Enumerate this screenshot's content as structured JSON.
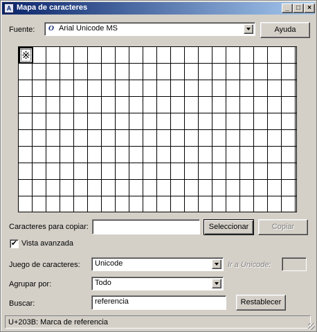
{
  "window": {
    "title": "Mapa de caracteres",
    "minimize": "_",
    "maximize": "□",
    "close": "×"
  },
  "font": {
    "label": "Fuente:",
    "value": "Arial Unicode MS",
    "icon_glyph": "O"
  },
  "help_button": "Ayuda",
  "grid": {
    "selected_char": "※",
    "rows": 10,
    "cols": 20
  },
  "copy": {
    "label": "Caracteres para copiar:",
    "value": "",
    "select_button": "Seleccionar",
    "copy_button": "Copiar"
  },
  "advanced": {
    "label": "Vista avanzada",
    "checked": true,
    "check_glyph": "✔"
  },
  "charset": {
    "label": "Juego de caracteres:",
    "value": "Unicode"
  },
  "goto_unicode": {
    "label": "Ir a Unicode:",
    "value": ""
  },
  "group_by": {
    "label": "Agrupar por:",
    "value": "Todo"
  },
  "search": {
    "label": "Buscar:",
    "value": "referencia",
    "reset_button": "Restablecer"
  },
  "status": {
    "text": "U+203B: Marca de referencia"
  }
}
